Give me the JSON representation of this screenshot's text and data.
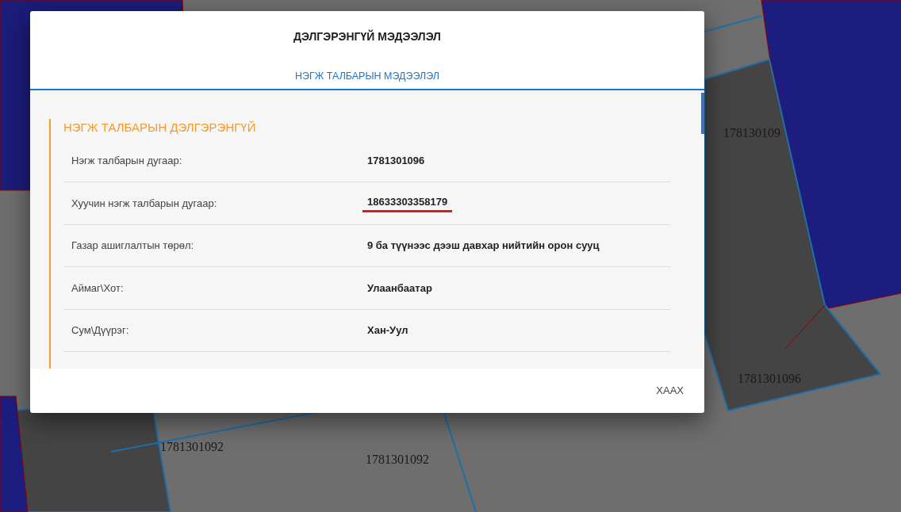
{
  "map": {
    "parcel_labels": [
      "178130109",
      "1781301096",
      "1781301092",
      "1781301092"
    ]
  },
  "dialog": {
    "title": "ДЭЛГЭРЭНГҮЙ МЭДЭЭЛЭЛ",
    "tabs": [
      {
        "label": "НЭГЖ ТАЛБАРЫН МЭДЭЭЛЭЛ",
        "selected": true
      }
    ],
    "section": {
      "title": "НЭГЖ ТАЛБАРЫН ДЭЛГЭРЭНГҮЙ",
      "rows": [
        {
          "label": "Нэгж талбарын дугаар:",
          "value": "1781301096",
          "underlined": false
        },
        {
          "label": "Хуучин нэгж талбарын дугаар:",
          "value": "18633303358179",
          "underlined": true
        },
        {
          "label": "Газар ашиглалтын төрөл:",
          "value": "9 ба түүнээс дээш давхар нийтийн орон сууц",
          "underlined": false
        },
        {
          "label": "Аймаг\\Хот:",
          "value": "Улаанбаатар",
          "underlined": false
        },
        {
          "label": "Сум\\Дүүрэг:",
          "value": "Хан-Уул",
          "underlined": false
        }
      ]
    },
    "buttons": [
      "ХААХ"
    ]
  }
}
